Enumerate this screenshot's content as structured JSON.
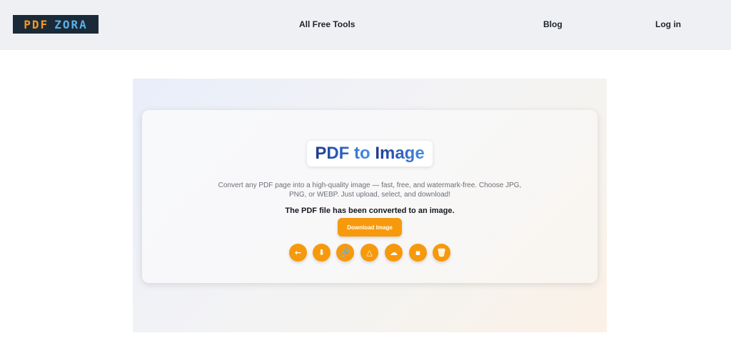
{
  "header": {
    "logo": {
      "left": "PDF",
      "right": "ZORA"
    },
    "nav": {
      "all_free_tools": "All Free Tools",
      "blog": "Blog",
      "login": "Log in"
    }
  },
  "hero": {
    "title_part1": "PDF to",
    "title_part2": "Image",
    "description": "Convert any PDF page into a high-quality image — fast, free, and watermark-free. Choose JPG, PNG, or WEBP. Just upload, select, and download!",
    "status": "The PDF file has been converted to an image.",
    "download_button": "Download Image",
    "icons": [
      {
        "name": "back-arrow-icon",
        "glyph": "←"
      },
      {
        "name": "download-icon",
        "glyph": "⬇"
      },
      {
        "name": "link-icon",
        "glyph": "🔗"
      },
      {
        "name": "google-drive-icon",
        "glyph": "△"
      },
      {
        "name": "cloud-icon",
        "glyph": "☁"
      },
      {
        "name": "computer-icon",
        "glyph": "▪"
      },
      {
        "name": "trash-icon",
        "glyph": "🗑"
      }
    ]
  },
  "colors": {
    "accent": "#f7990c",
    "title_dark": "#1e3a8a",
    "title_light": "#4a90e2"
  }
}
